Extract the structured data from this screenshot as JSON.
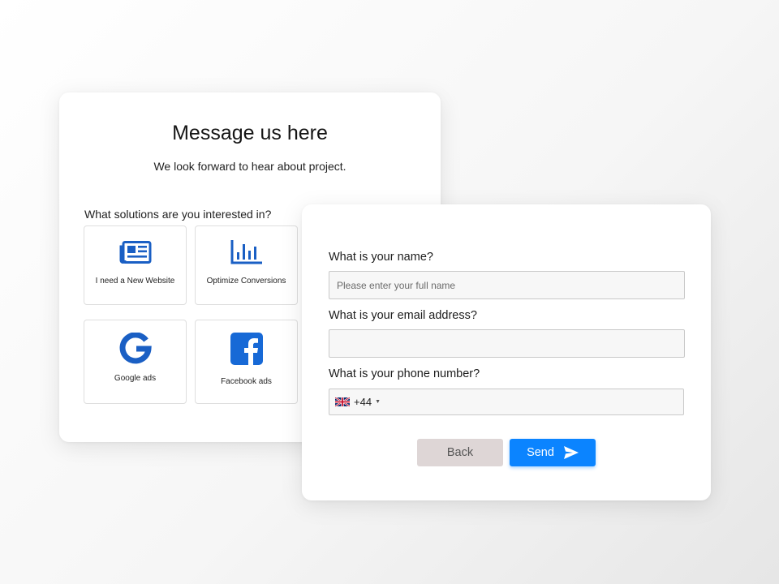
{
  "intro_card": {
    "title": "Message us here",
    "subtitle": "We look forward to hear about project.",
    "solutions_label": "What solutions are you interested in?",
    "solutions": [
      {
        "label": "I need a New Website",
        "icon": "newspaper-icon"
      },
      {
        "label": "Optimize Conversions",
        "icon": "bar-chart-icon"
      },
      {
        "label": "Google ads",
        "icon": "google-icon"
      },
      {
        "label": "Facebook ads",
        "icon": "facebook-icon"
      }
    ]
  },
  "contact_form": {
    "name_label": "What is your name?",
    "name_placeholder": "Please enter your full name",
    "name_value": "",
    "email_label": "What is your email address?",
    "email_value": "",
    "phone_label": "What is your phone number?",
    "phone_country_icon": "uk-flag-icon",
    "phone_dial_code": "+44",
    "phone_value": "",
    "back_label": "Back",
    "send_label": "Send"
  },
  "colors": {
    "accent_blue": "#0b84ff",
    "icon_blue": "#1a5fc4",
    "facebook_blue": "#1769d6",
    "back_button": "#ded6d6"
  }
}
